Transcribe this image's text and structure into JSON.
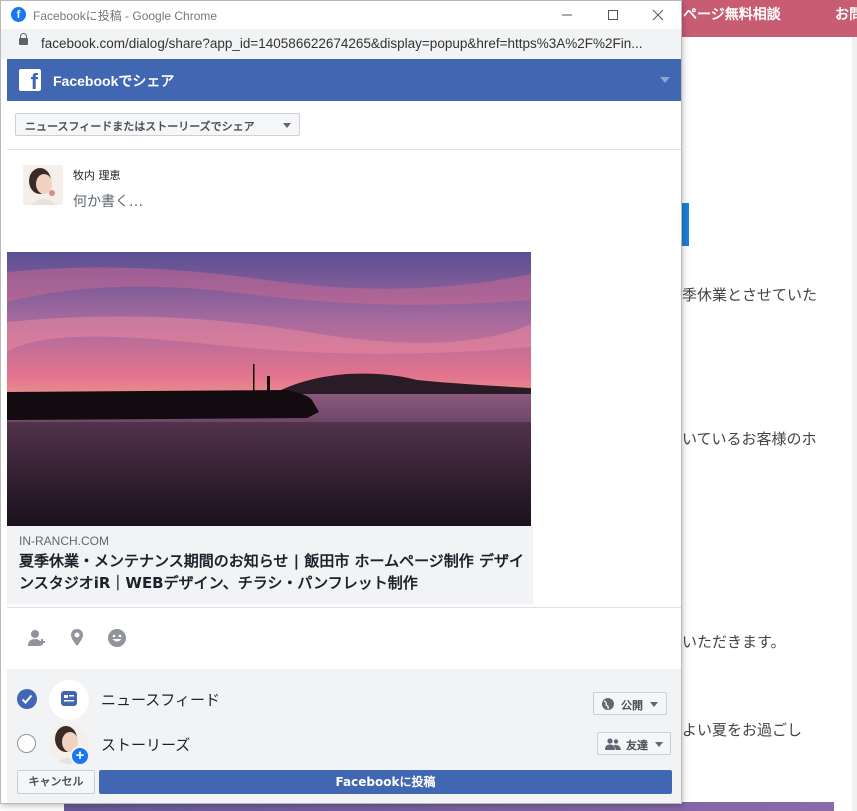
{
  "background_page": {
    "nav_item": "ページ無料相談",
    "nav_item_2": "お問",
    "lines": [
      "季休業とさせていた",
      "いているお客様のホ",
      "いただきます。",
      "よい夏をお過ごし"
    ]
  },
  "browser": {
    "window_title": "Facebookに投稿 - Google Chrome",
    "url": "facebook.com/dialog/share?app_id=140586622674265&display=popup&href=https%3A%2F%2Fin..."
  },
  "dialog": {
    "title": "Facebookでシェア",
    "share_target": "ニュースフィードまたはストーリーズでシェア",
    "user_name": "牧内 理恵",
    "composer_placeholder": "何か書く…",
    "link": {
      "domain": "IN-RANCH.COM",
      "title": "夏季休業・メンテナンス期間のお知らせ | 飯田市 ホームページ制作 デザインスタジオiR｜WEBデザイン、チラシ・パンフレット制作"
    },
    "destinations": [
      {
        "label": "ニュースフィード",
        "checked": true,
        "privacy": "公開"
      },
      {
        "label": "ストーリーズ",
        "checked": false,
        "privacy": "友達"
      }
    ],
    "cancel_label": "キャンセル",
    "post_label": "Facebookに投稿"
  },
  "colors": {
    "facebook_blue": "#4267b2",
    "site_header": "#c85c73"
  }
}
